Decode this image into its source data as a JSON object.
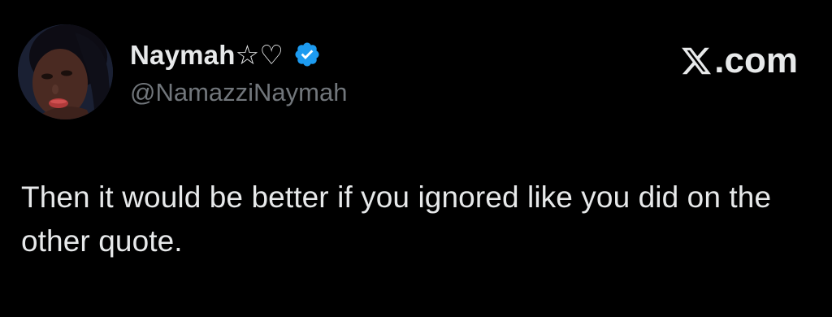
{
  "tweet": {
    "author": {
      "display_name": "Naymah☆♡",
      "handle": "@NamazziNaymah",
      "verified": true,
      "verified_icon": "verified-badge-icon",
      "verified_color": "#1d9bf0"
    },
    "brand": {
      "label": ".com",
      "icon": "x-logo-icon"
    },
    "text": "Then it would be better if you ignored like you did on the other quote."
  },
  "colors": {
    "background": "#000000",
    "primary_text": "#e7e9ea",
    "secondary_text": "#71767b",
    "accent": "#1d9bf0"
  }
}
